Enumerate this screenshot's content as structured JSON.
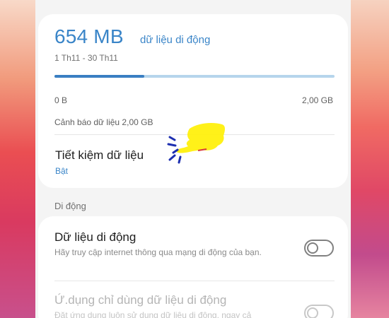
{
  "usage": {
    "amount": "654 MB",
    "label": "dữ liệu di động",
    "period": "1 Th11 - 30 Th11",
    "progress_fraction": 0.32,
    "min_label": "0 B",
    "max_label": "2,00 GB",
    "warning": "Cảnh báo dữ liệu 2,00 GB"
  },
  "data_saver": {
    "title": "Tiết kiệm dữ liệu",
    "status": "Bật"
  },
  "section": {
    "header": "Di động"
  },
  "mobile_data": {
    "title": "Dữ liệu di động",
    "description": "Hãy truy cập internet thông qua mạng di động của bạn.",
    "enabled": false
  },
  "mobile_only_apps": {
    "title": "Ứ.dụng chỉ dùng dữ liệu di động",
    "description": "Đặt ứng dụng luôn sử dụng dữ liệu di động, ngay cả",
    "enabled": false
  },
  "colors": {
    "accent": "#3a85c8",
    "bar_fill": "#3a7fc2",
    "bar_track": "#b6d5ec",
    "annotation_highlight": "#ffef00",
    "annotation_marks": "#1d2fb0"
  }
}
